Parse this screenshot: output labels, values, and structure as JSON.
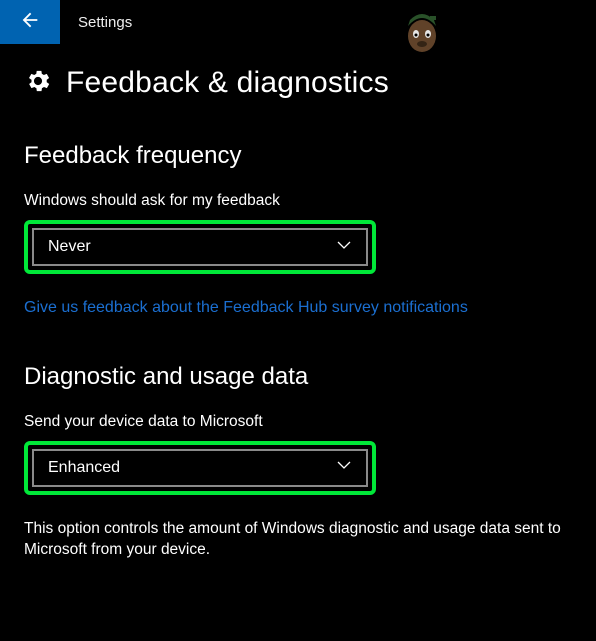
{
  "header": {
    "title": "Settings"
  },
  "page": {
    "title": "Feedback & diagnostics"
  },
  "feedback_frequency": {
    "heading": "Feedback frequency",
    "label": "Windows should ask for my feedback",
    "selected": "Never",
    "link": "Give us feedback about the Feedback Hub survey notifications"
  },
  "diagnostic": {
    "heading": "Diagnostic and usage data",
    "label": "Send your device data to Microsoft",
    "selected": "Enhanced",
    "description": "This option controls the amount of Windows diagnostic and usage data sent to Microsoft from your device."
  },
  "colors": {
    "accent": "#0063b1",
    "link": "#1b6fd1",
    "highlight": "#00e838"
  }
}
